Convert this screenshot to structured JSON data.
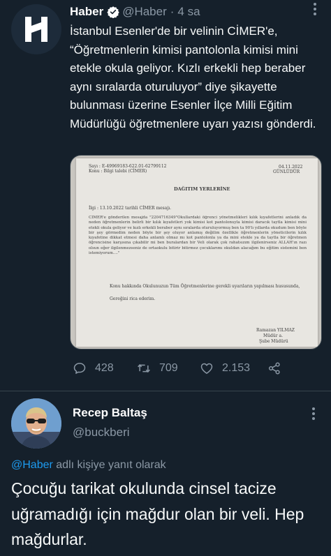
{
  "tweet": {
    "author_name": "Haber",
    "author_handle": "@Haber",
    "separator": "·",
    "time": "4 sa",
    "text": "İstanbul Esenler'de bir velinin CİMER'e, “Öğretmenlerin kimisi pantolonla kimisi mini etekle okula geliyor. Kızlı erkekli hep beraber aynı sıralarda oturuluyor” diye şikayette bulunması üzerine Esenler İlçe Milli Eğitim Müdürlüğü öğretmenlere uyarı yazısı gönderdi.",
    "avatar_letter": "H",
    "reply_count": "428",
    "retweet_count": "709",
    "like_count": "2.153"
  },
  "document": {
    "sayi": "Sayı  : E-49969183-622.01-62799112",
    "konu": "Konu  : Bilgi talebi (CİMER)",
    "date": "04.11.2022",
    "urgency": "GÜNLÜDÜR",
    "heading": "DAĞITIM YERLERİNE",
    "ilgi": "İlgi      : 13.10.2022 tarihli CİMER mesajı.",
    "paragraph": "CİMER'e gönderilen mesajda \"2204716349\"Okullardaki öğrenci yönetmelikleri kılık kıyafetlerini anladık da neden öğretmenlerin belirli bir kılık kıyafetleri yok kimisi kot pantolonuyla kimisi daracık taytla kimisi mini etekli okula geliyor ve kızlı erkekli beraber aynı sıralarda oturuluyormuş ben ta 90'lı yıllarda okudum ben böyle bir şey görmedim neden böyle bir şey oluyor anlamış değilim özellikle öğretmenlerin yöneticilerin kılık kıyafetine dikkat etmesi daha anlamlı olmaz mı kot pantolonla ya da mini etekle ya da taytla bir öğretmen öğrencisine karşısına çıkabilir mi ben buralardan bir Veli olarak çok rahatsızım ilgilenirseniz ALLAH'ın razı olsun eğer ilgilenmezseniz de ortaokulu bitirir bitirmez çocuklarımı okuldan alacağım bu eğitim sistemini ben istemiyorum....\"",
    "line2": "Konu hakkında Okulunuzun Tüm Öğretmenlerine gerekli uyarıların yapılması hususunda,",
    "line3": "Gereğini rica ederim.",
    "signer_name": "Ramazan YILMAZ",
    "signer_title1": "Müdür a.",
    "signer_title2": "Şube Müdürü"
  },
  "reply": {
    "author_name": "Recep Baltaş",
    "author_handle": "@buckberi",
    "replying_mention": "@Haber",
    "replying_suffix": " adlı kişiye yanıt olarak",
    "text": "Çocuğu tarikat okulunda cinsel tacize uğramadığı için mağdur olan bir veli. Hep mağdurlar."
  },
  "colors": {
    "background": "#15202b",
    "secondary_text": "#8b98a5",
    "accent": "#1d9bf0",
    "divider": "#38444d"
  },
  "icons": [
    "verified-badge-icon",
    "more-icon",
    "reply-icon",
    "retweet-icon",
    "like-icon",
    "share-icon"
  ]
}
